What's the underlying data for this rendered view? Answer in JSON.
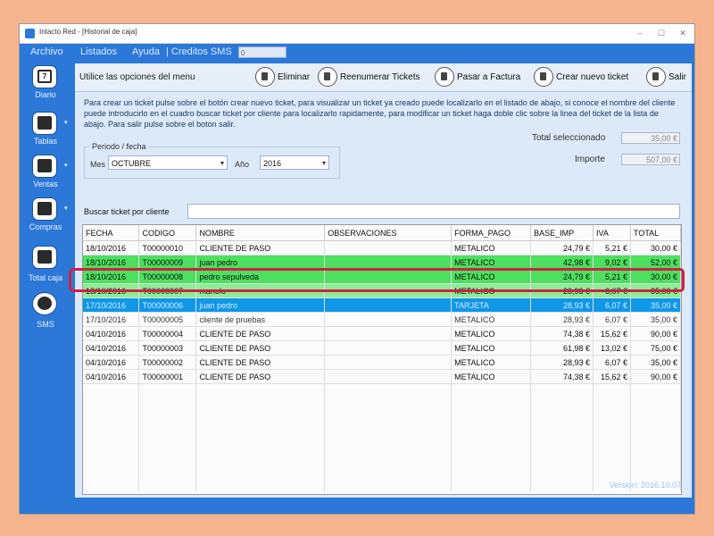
{
  "window": {
    "title": "Intacto Red - [Historial de caja]"
  },
  "menu": {
    "items": [
      "Archivo",
      "Listados",
      "Ayuda",
      "| Creditos SMS"
    ],
    "sms_credits": "0"
  },
  "sidebar": {
    "items": [
      {
        "label": "Diario",
        "icon": "calendar-icon",
        "badge": "7"
      },
      {
        "label": "Tablas",
        "icon": "list-icon"
      },
      {
        "label": "Ventas",
        "icon": "sales-icon"
      },
      {
        "label": "Compras",
        "icon": "clipboard-icon"
      },
      {
        "label": "Total caja",
        "icon": "calculator-icon"
      },
      {
        "label": "SMS",
        "icon": "sms-icon"
      }
    ]
  },
  "toolbar": {
    "hint": "Utilice las opciones del menu",
    "eliminar": "Eliminar",
    "reenumerar": "Reenumerar Tickets",
    "factura": "Pasar a Factura",
    "nuevo": "Crear nuevo ticket",
    "salir": "Salir"
  },
  "info": {
    "text": "Para crear un ticket pulse sobre el botón crear nuevo ticket, para visualizar un ticket ya creado puede localizarlo en el listado de abajo, si conoce el nombre del cliente puede introducirlo en el cuadro buscar ticket por cliente para localizarlo rapidamente, para modificar un ticket haga doble clic sobre la linea del ticket de la lista de abajo. Para salir pulse sobre el boton salir."
  },
  "totals": {
    "seleccionado_label": "Total seleccionado",
    "seleccionado_value": "35,00 €",
    "importe_label": "Importe",
    "importe_value": "507,00 €"
  },
  "period": {
    "legend": "Periodo / fecha",
    "mes_label": "Mes",
    "mes_value": "OCTUBRE",
    "ano_label": "Año",
    "ano_value": "2016"
  },
  "search": {
    "label": "Buscar ticket por cliente",
    "value": ""
  },
  "table": {
    "columns": [
      "FECHA",
      "CODIGO",
      "NOMBRE",
      "OBSERVACIONES",
      "FORMA_PAGO",
      "BASE_IMP",
      "IVA",
      "TOTAL"
    ],
    "rows": [
      {
        "fecha": "18/10/2016",
        "codigo": "T00000010",
        "nombre": "CLIENTE DE PASO",
        "obs": "",
        "pago": "METALICO",
        "base": "24,79 €",
        "iva": "5,21 €",
        "total": "30,00 €",
        "style": "normal"
      },
      {
        "fecha": "18/10/2016",
        "codigo": "T00000009",
        "nombre": "juan pedro",
        "obs": "",
        "pago": "METALICO",
        "base": "42,98 €",
        "iva": "9,02 €",
        "total": "52,00 €",
        "style": "green"
      },
      {
        "fecha": "18/10/2016",
        "codigo": "T00000008",
        "nombre": "pedro sepulveda",
        "obs": "",
        "pago": "METALICO",
        "base": "24,79 €",
        "iva": "5,21 €",
        "total": "30,00 €",
        "style": "green"
      },
      {
        "fecha": "18/10/2016",
        "codigo": "T00000007",
        "nombre": "manolo",
        "obs": "",
        "pago": "METALICO",
        "base": "28,93 €",
        "iva": "6,07 €",
        "total": "35,00 €",
        "style": "green-light"
      },
      {
        "fecha": "17/10/2016",
        "codigo": "T00000006",
        "nombre": "juan pedro",
        "obs": "",
        "pago": "TARJETA",
        "base": "28,93 €",
        "iva": "6,07 €",
        "total": "35,00 €",
        "style": "blue"
      },
      {
        "fecha": "17/10/2016",
        "codigo": "T00000005",
        "nombre": "cliente de pruebas",
        "obs": "",
        "pago": "METALICO",
        "base": "28,93 €",
        "iva": "6,07 €",
        "total": "35,00 €",
        "style": "dim"
      },
      {
        "fecha": "04/10/2016",
        "codigo": "T00000004",
        "nombre": "CLIENTE DE PASO",
        "obs": "",
        "pago": "METALICO",
        "base": "74,38 €",
        "iva": "15,62 €",
        "total": "90,00 €",
        "style": "normal"
      },
      {
        "fecha": "04/10/2016",
        "codigo": "T00000003",
        "nombre": "CLIENTE DE PASO",
        "obs": "",
        "pago": "METALICO",
        "base": "61,98 €",
        "iva": "13,02 €",
        "total": "75,00 €",
        "style": "normal"
      },
      {
        "fecha": "04/10/2016",
        "codigo": "T00000002",
        "nombre": "CLIENTE DE PASO",
        "obs": "",
        "pago": "METALICO",
        "base": "28,93 €",
        "iva": "6,07 €",
        "total": "35,00 €",
        "style": "normal"
      },
      {
        "fecha": "04/10/2016",
        "codigo": "T00000001",
        "nombre": "CLIENTE DE PASO",
        "obs": "",
        "pago": "METALICO",
        "base": "74,38 €",
        "iva": "15,62 €",
        "total": "90,00 €",
        "style": "normal"
      }
    ]
  },
  "status": {
    "version": "Version: 2016.10.07"
  },
  "colors": {
    "accent": "#2b78d9",
    "selected_row": "#0f98e8",
    "marked_row": "#4ce05e",
    "highlight_border": "#d21f45"
  }
}
